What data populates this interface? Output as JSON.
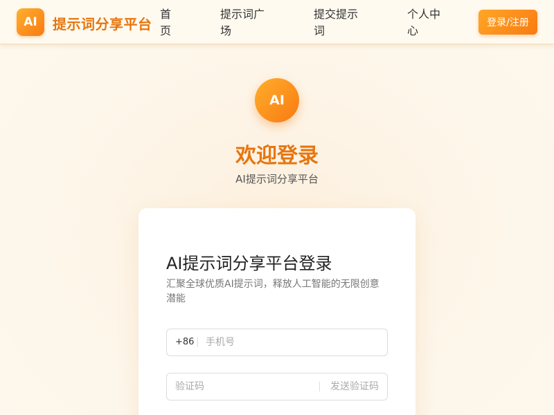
{
  "header": {
    "logo_text": "AI",
    "brand": "提示词分享平台",
    "nav": [
      "首页",
      "提示词广场",
      "提交提示词",
      "个人中心"
    ],
    "login_button": "登录/注册"
  },
  "hero": {
    "badge_text": "AI",
    "title": "欢迎登录",
    "subtitle": "AI提示词分享平台"
  },
  "card": {
    "title": "AI提示词分享平台登录",
    "description": "汇聚全球优质AI提示词，释放人工智能的无限创意潜能",
    "phone": {
      "prefix": "+86",
      "placeholder": "手机号",
      "value": ""
    },
    "code": {
      "placeholder": "验证码",
      "value": "",
      "send_label": "发送验证码"
    }
  },
  "colors": {
    "accent": "#f97a12",
    "brand_text": "#e6760f",
    "page_bg": "#fdf5e8"
  }
}
